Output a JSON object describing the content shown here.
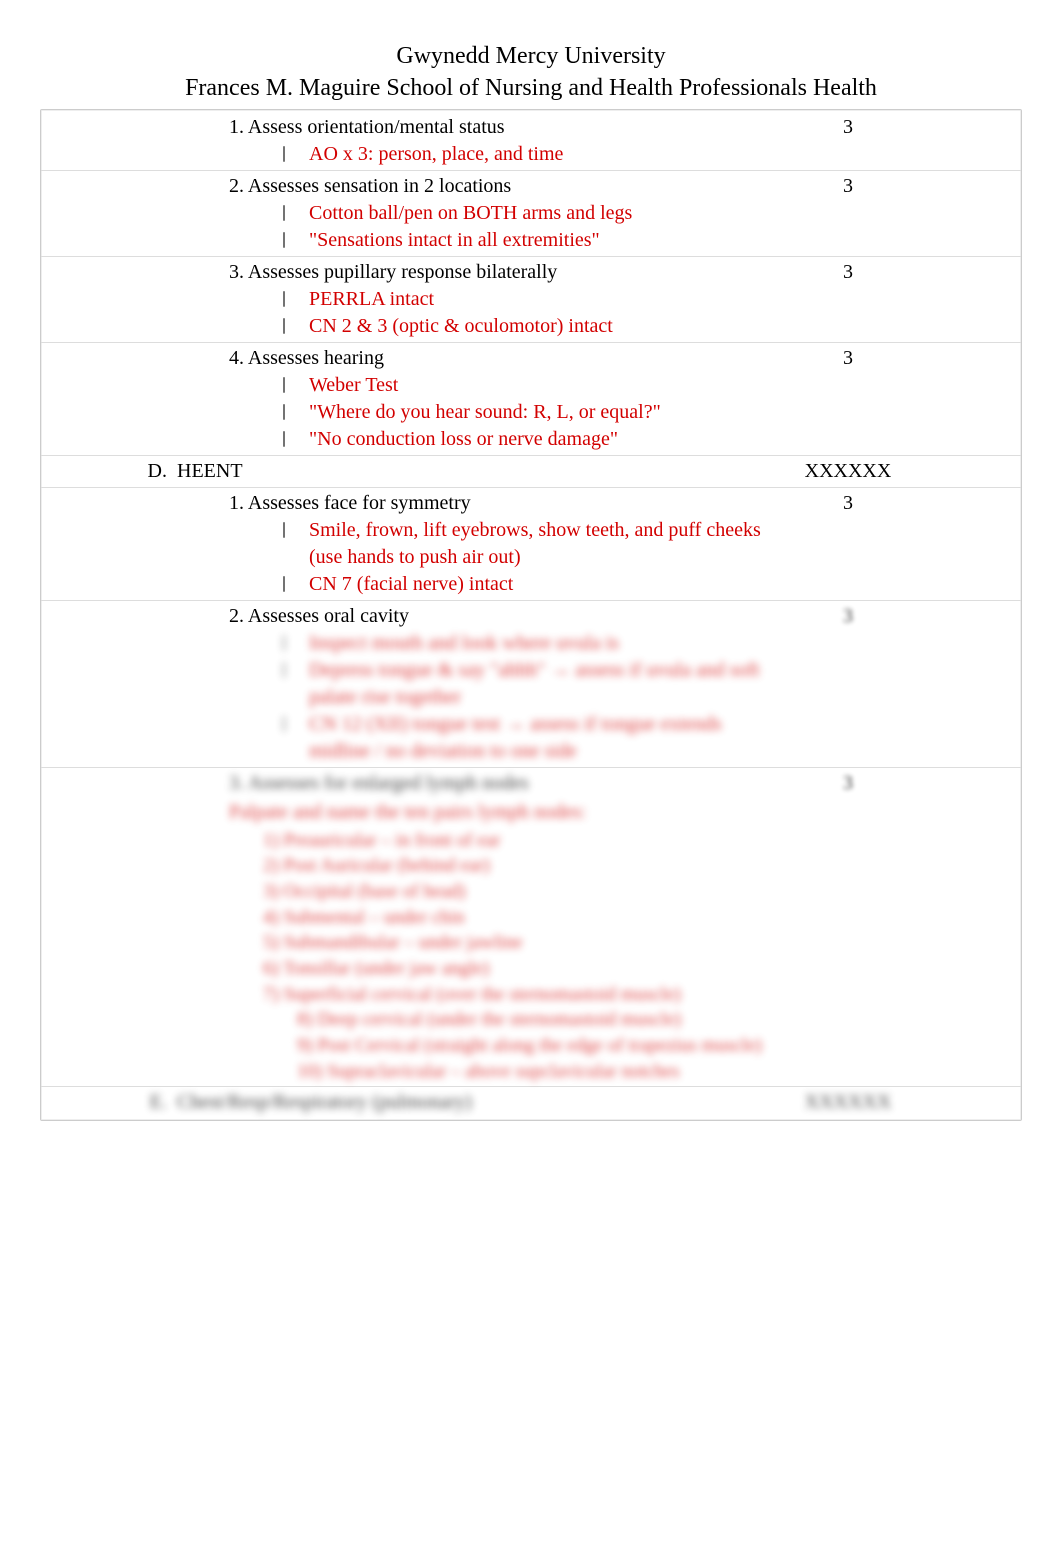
{
  "header": {
    "title_line1": "Gwynedd Mercy University",
    "title_line2": "Frances M. Maguire School of Nursing and Health Professionals Health"
  },
  "rows": [
    {
      "section": "",
      "num": "1.",
      "title": "Assess orientation/mental status",
      "bullets": [
        "AO x 3: person, place, and time"
      ],
      "score": "3"
    },
    {
      "num": "2.",
      "title": "Assesses sensation in 2 locations",
      "bullets": [
        "Cotton ball/pen on BOTH arms and legs",
        "\"Sensations intact in all extremities\""
      ],
      "score": "3"
    },
    {
      "num": "3.",
      "title": "Assesses pupillary response bilaterally",
      "bullets": [
        "PERRLA intact",
        "CN 2 & 3 (optic & oculomotor) intact"
      ],
      "score": "3"
    },
    {
      "num": "4.",
      "title": "Assesses hearing",
      "bullets": [
        "Weber Test",
        "\"Where do you hear sound: R, L, or equal?\"",
        "\"No conduction loss or nerve damage\""
      ],
      "score": "3"
    }
  ],
  "section_d": {
    "letter": "D.",
    "label": "HEENT",
    "score": "XXXXXX"
  },
  "d_rows": [
    {
      "num": "1.",
      "title": "Assesses face for symmetry",
      "bullets": [
        "Smile, frown, lift eyebrows, show teeth, and puff cheeks (use hands to push air out)",
        "CN 7 (facial nerve) intact"
      ],
      "score": "3"
    },
    {
      "num": "2.",
      "title": "Assesses oral cavity",
      "bullets_blurred": [
        "Inspect mouth and look where uvula is",
        "Depress tongue & say \"ahhh\" → assess if uvula and soft palate rise together",
        "CN 12 (XII) tongue test → assess if tongue extends midline / no deviation to one side"
      ],
      "score": "3"
    }
  ],
  "d_blurred_item": {
    "num": "3.",
    "title": "Assesses for enlarged lymph nodes",
    "intro": "Palpate and name the ten pairs lymph nodes:",
    "list": [
      "1) Preauricular – in front of ear",
      "2) Post Auricular (behind ear)",
      "3) Occipital (base of head)",
      "4) Submental – under chin",
      "5) Submandibular – under jawline",
      "6) Tonsillar (under jaw angle)",
      "7) Superficial cervical (over the sternomastoid muscle)",
      "8) Deep cervical (under the sternomastoid muscle)",
      "9) Post Cervical (straight along the edge of trapezius muscle)",
      "10) Supraclavicular – above supclavicular notches"
    ],
    "score": "3"
  },
  "section_e": {
    "letter": "E.",
    "label": "Chest/Resp/Respiratory (pulmonary)",
    "score": "XXXXXX"
  }
}
